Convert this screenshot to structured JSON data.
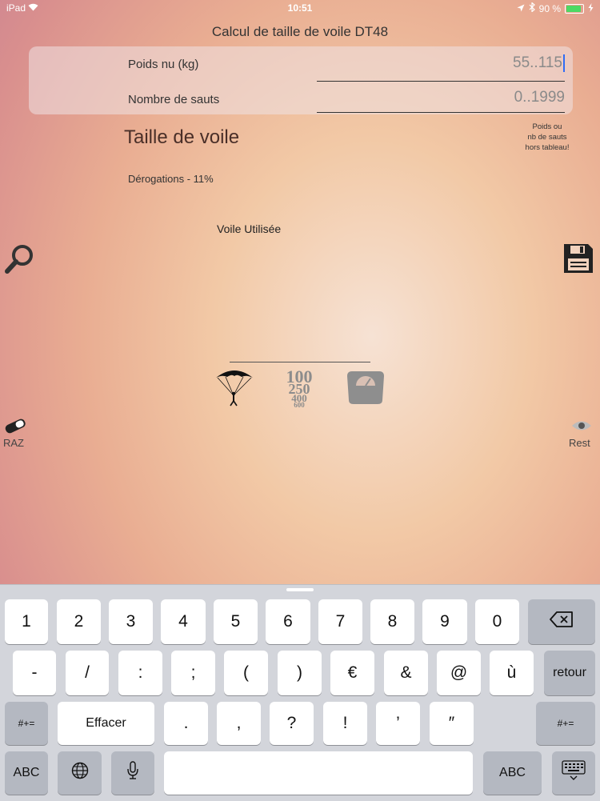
{
  "status_bar": {
    "device": "iPad",
    "time": "10:51",
    "battery": "90 %",
    "battery_level": 0.9
  },
  "app": {
    "title": "Calcul de taille de voile DT48"
  },
  "form": {
    "weight": {
      "label": "Poids nu (kg)",
      "value": "55..115"
    },
    "jumps": {
      "label": "Nombre de sauts",
      "value": "0..1999"
    }
  },
  "result": {
    "title": "Taille de voile",
    "warning": [
      "Poids ou",
      "nb de sauts",
      "hors tableau!"
    ],
    "derogations": "Dérogations  - 11%",
    "voile_label": "Voile Utilisée"
  },
  "side_buttons": {
    "raz_label": "RAZ",
    "rest_label": "Rest"
  },
  "center_icons": {
    "numbers": [
      "100",
      "250",
      "400",
      "600"
    ]
  },
  "keyboard": {
    "row1": [
      "1",
      "2",
      "3",
      "4",
      "5",
      "6",
      "7",
      "8",
      "9",
      "0"
    ],
    "row2": [
      "-",
      "/",
      ":",
      ";",
      "(",
      ")",
      "€",
      "&",
      "@",
      "ù"
    ],
    "return_label": "retour",
    "shift_label": "#+=",
    "erase_label": "Effacer",
    "row3": [
      ".",
      ",",
      "?",
      "!",
      "’",
      "″"
    ],
    "abc_label": "ABC"
  }
}
